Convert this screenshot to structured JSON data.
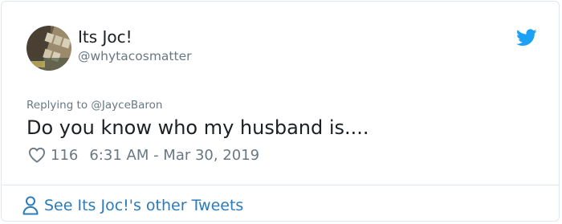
{
  "tweet": {
    "author": {
      "display_name": "Its Joc!",
      "handle": "@whytacosmatter",
      "avatar_icon": "avatar-photo"
    },
    "platform_icon": "twitter-bird-icon",
    "replying_to": {
      "prefix": "Replying to",
      "mention": "@JayceBaron"
    },
    "text": "Do you know who my husband is....",
    "likes": "116",
    "timestamp": "6:31 AM - Mar 30, 2019",
    "footer_link": "See Its Joc!'s other Tweets"
  },
  "colors": {
    "accent": "#1da1f2",
    "link": "#2b7bb9",
    "secondary_text": "#697882",
    "primary_text": "#1c2022",
    "border": "#e1e8ed"
  }
}
